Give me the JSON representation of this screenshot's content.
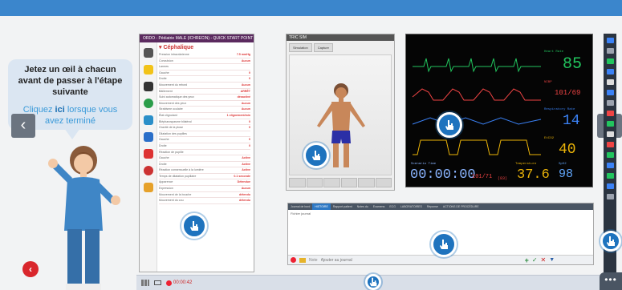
{
  "bubble": {
    "line1": "Jetez un œil à chacun avant de passer à l'étape suivante",
    "link_pre": "Cliquez ",
    "link_bold": "ici",
    "link_post": " lorsque vous avez terminé"
  },
  "nav": {
    "prev": "‹",
    "next": "›",
    "back": "‹",
    "menu": "•••"
  },
  "ordo": {
    "title": "ORDO - Pédiatrie MALE (ICHRECIN) - QUICK START POINT",
    "section": "Céphalique",
    "rows": [
      {
        "label": "Pression intracrânienne",
        "value": "7.5 mmHg"
      },
      {
        "label": "Convulsion",
        "value": "Aucun"
      },
      {
        "label": "Larmes",
        "value": ""
      },
      {
        "label": "Gauche",
        "value": "0"
      },
      {
        "label": "Droite",
        "value": "0"
      },
      {
        "label": "Mouvement du rebord",
        "value": "Aucun"
      },
      {
        "label": "Bâillement",
        "value": "ARRÊT"
      },
      {
        "label": "Suivi automatique des yeux",
        "value": "désactivé"
      },
      {
        "label": "Mouvement des yeux",
        "value": "Aucun"
      },
      {
        "label": "Strabisme oculaire",
        "value": "Aucun"
      },
      {
        "label": "État clignotant",
        "value": "1 clignement/min"
      },
      {
        "label": "Blépharospasme bilatéral",
        "value": "0"
      },
      {
        "label": "Gravité de la ptose",
        "value": "0"
      },
      {
        "label": "Dilatation des pupilles",
        "value": ""
      },
      {
        "label": "Gauche",
        "value": "0"
      },
      {
        "label": "Droite",
        "value": "0"
      },
      {
        "label": "Réaction de pupille",
        "value": ""
      },
      {
        "label": "Gauche",
        "value": "Active"
      },
      {
        "label": "Droite",
        "value": "Active"
      },
      {
        "label": "Réaction consensuelle à la lumière",
        "value": "Active"
      },
      {
        "label": "Temps de dilatation pupillaire",
        "value": "0.1 seconde"
      },
      {
        "label": "Apparence",
        "value": "Détendue"
      },
      {
        "label": "Expression",
        "value": "Aucun"
      },
      {
        "label": "Mouvement de la bouche",
        "value": "détendu"
      },
      {
        "label": "Mouvement du cou",
        "value": "détendu"
      }
    ]
  },
  "viewer": {
    "title": "TRIC SIM",
    "tabs": [
      "Simulation",
      "Capture"
    ]
  },
  "monitor": {
    "hr": "85",
    "bp": "101/69",
    "rr": "14",
    "etco2": "40",
    "temp": "37.6",
    "spo2": "98",
    "nibp": "101/71",
    "map": "(83)",
    "timer": "00:00:00",
    "labels": {
      "hr": "Heart Rate",
      "bp": "NIBP",
      "rr": "Respiratory Rate",
      "etco2": "EtCO2",
      "temp": "Temperature",
      "spo2": "SpO2",
      "timer": "Scenario Time"
    }
  },
  "journal": {
    "tabs": [
      "Journal de bord",
      "HISTOIRE",
      "Rapport patient",
      "Notes du",
      "Examens",
      "ECG",
      "LABORATOIRES",
      "Réponse",
      "ACTIONS DE PROCÉDURE"
    ],
    "active_tab": 1,
    "label": "Fichier journal",
    "placeholder": "Ajouter au journal",
    "note_label": "Note"
  },
  "bottombar": {
    "timer": "00:00:42"
  },
  "colors": {
    "topbar": "#3b86cc",
    "hand": "#1e73be",
    "hr": "#22c55e",
    "bp": "#ef4444",
    "rr": "#3b82f6",
    "etco2": "#eab308"
  }
}
